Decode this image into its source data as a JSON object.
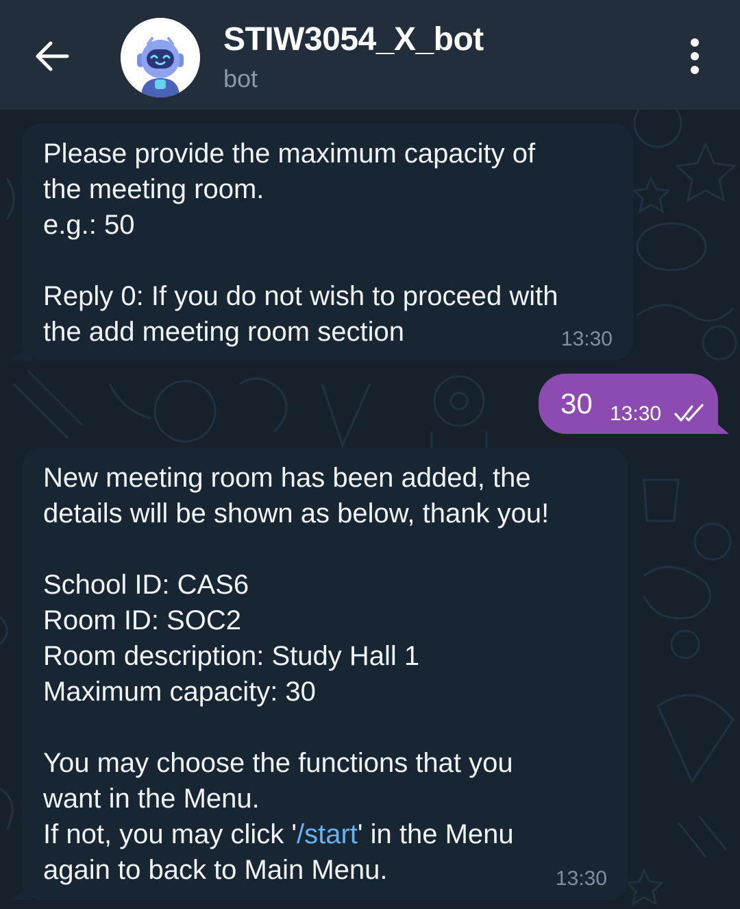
{
  "header": {
    "title": "STIW3054_X_bot",
    "subtitle": "bot",
    "back_icon": "arrow-left-icon",
    "menu_icon": "more-vertical-icon",
    "avatar_icon": "robot-avatar"
  },
  "messages": [
    {
      "direction": "incoming",
      "text": "Please provide the maximum capacity of\nthe meeting room.\ne.g.: 50\n\nReply 0: If you do not wish to proceed with\nthe add meeting room section",
      "time": "13:30"
    },
    {
      "direction": "outgoing",
      "text": "30",
      "time": "13:30",
      "status_icon": "double-check-icon"
    },
    {
      "direction": "incoming",
      "text_part1": "New meeting room has been added, the\ndetails will be shown as below, thank you!\n\nSchool ID: CAS6\nRoom ID: SOC2\nRoom description: Study Hall 1\nMaximum capacity: 30\n\nYou may choose the functions that you\nwant in the Menu.\nIf not, you may click '",
      "link": "/start",
      "text_part2": "' in the Menu\nagain to back to Main Menu.",
      "time": "13:30"
    }
  ],
  "colors": {
    "background": "#17212b",
    "header": "#232e3c",
    "incoming_bubble": "#182533",
    "outgoing_bubble": "#8b4bb0",
    "link": "#6ab3f3"
  }
}
